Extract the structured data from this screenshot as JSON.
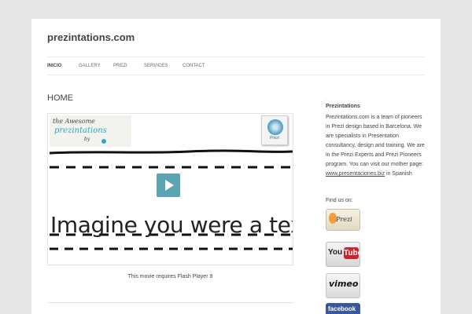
{
  "site": {
    "title": "prezintations.com"
  },
  "nav": {
    "items": [
      {
        "label": "INICIO",
        "active": true
      },
      {
        "label": "GALLERY",
        "active": false
      },
      {
        "label": "PREZI",
        "active": false
      },
      {
        "label": "SERVICES",
        "active": false
      },
      {
        "label": "CONTACT",
        "active": false
      }
    ]
  },
  "main": {
    "heading": "HOME",
    "hero": {
      "logo_line1": "the Awesome",
      "logo_line2": "prezintations",
      "logo_line3": "by",
      "badge_label": "Prezi",
      "text": "Imagine you were a text"
    },
    "flash_note": "This movie requires Flash Player 9"
  },
  "sidebar": {
    "dot": "·",
    "title": "Prezintations",
    "desc_before": "Prezintations.com is a team of pioneers in Prezi design based in Barcelona. We are specialists in Presentation consultancy, design and training. We are in the Prezi Experts and Prezi Pioneers program. You can visit our mother page: ",
    "link_text": "www.presentaciones.biz",
    "desc_after": " in Spanish",
    "find_us": "Find us on:",
    "social": {
      "prezi": "Prezi",
      "youtube_you": "You",
      "youtube_tube": "Tube",
      "vimeo": "vimeo",
      "facebook": "facebook"
    }
  },
  "colors": {
    "play_button": "#5aa4b4",
    "facebook": "#3b5998",
    "youtube_red": "#d2232a",
    "logo_blue": "#2aa7c9"
  }
}
